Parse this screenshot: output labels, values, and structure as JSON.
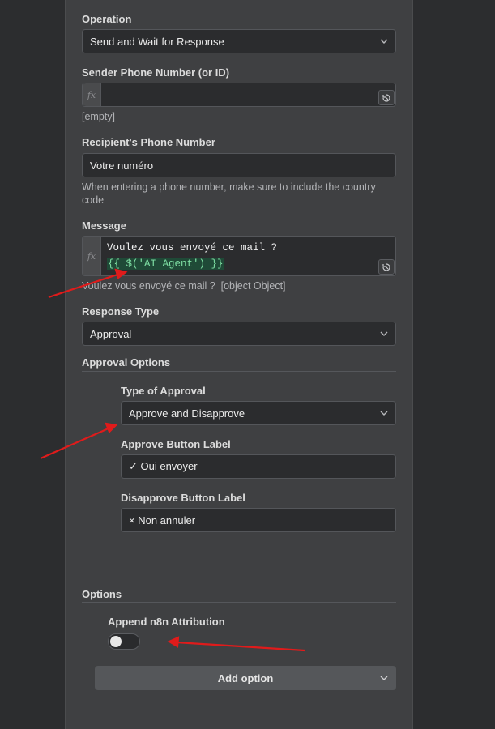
{
  "operation": {
    "label": "Operation",
    "value": "Send and Wait for Response"
  },
  "sender": {
    "label": "Sender Phone Number (or ID)",
    "fx": "fx",
    "empty_hint": "[empty]"
  },
  "recipient": {
    "label": "Recipient's Phone Number",
    "value": "Votre numéro",
    "hint_line1": "When entering a phone number, make sure to include the country",
    "hint_line2": "code"
  },
  "message": {
    "label": "Message",
    "fx": "fx",
    "line1": "Voulez vous envoyé ce mail ?",
    "expression": "{{ $('AI Agent') }}",
    "preview": "Voulez vous envoyé ce mail ?  [object Object]"
  },
  "response_type": {
    "label": "Response Type",
    "value": "Approval"
  },
  "approval_options": {
    "heading": "Approval Options",
    "type_label": "Type of Approval",
    "type_value": "Approve and Disapprove",
    "approve_label": "Approve Button Label",
    "approve_value": "✓ Oui envoyer",
    "disapprove_label": "Disapprove Button Label",
    "disapprove_value": "× Non annuler"
  },
  "options": {
    "heading": "Options",
    "append_label": "Append n8n Attribution",
    "append_enabled": false,
    "add_option": "Add option"
  },
  "colors": {
    "annotation_arrow": "#e01b1b",
    "expression_bg": "#1f4a37",
    "expression_text": "#7fe0a4"
  }
}
